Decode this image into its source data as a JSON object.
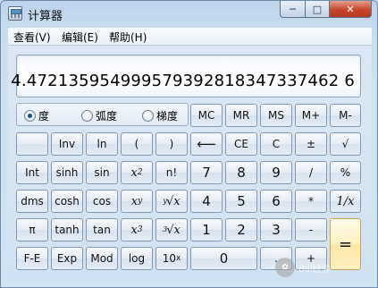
{
  "window": {
    "title": "计算器"
  },
  "titlebar_buttons": {
    "minimize": "─",
    "maximize": "□",
    "close": "✕"
  },
  "menu": [
    {
      "label": "查看(V)"
    },
    {
      "label": "编辑(E)"
    },
    {
      "label": "帮助(H)"
    }
  ],
  "display": {
    "value": "4.472135954999579392818347337462 6"
  },
  "angle_units": {
    "selected": "度",
    "options": [
      {
        "label": "度",
        "selected": true
      },
      {
        "label": "弧度",
        "selected": false
      },
      {
        "label": "梯度",
        "selected": false
      }
    ]
  },
  "keys": {
    "mc": "MC",
    "mr": "MR",
    "ms": "MS",
    "mplus": "M+",
    "mminus": "M-",
    "blank": "",
    "inv": "Inv",
    "ln": "ln",
    "lparen": "(",
    "rparen": ")",
    "backspace": "⟵",
    "ce": "CE",
    "c": "C",
    "plusminus": "±",
    "sqrt": "√",
    "int": "Int",
    "sinh": "sinh",
    "sin": "sin",
    "x2": "x",
    "x2_sup": "2",
    "nfact": "n!",
    "d7": "7",
    "d8": "8",
    "d9": "9",
    "div": "/",
    "pct": "%",
    "dms": "dms",
    "cosh": "cosh",
    "cos": "cos",
    "xy": "x",
    "xy_sup": "y",
    "yrootx_idx": "y",
    "yrootx": "√x",
    "d4": "4",
    "d5": "5",
    "d6": "6",
    "mul": "*",
    "recip": "1/x",
    "pi": "π",
    "tanh": "tanh",
    "tan": "tan",
    "x3": "x",
    "x3_sup": "3",
    "cbrt_idx": "3",
    "cbrt": "√x",
    "d1": "1",
    "d2": "2",
    "d3": "3",
    "sub": "-",
    "equals": "=",
    "fe": "F-E",
    "exp": "Exp",
    "mod": "Mod",
    "log": "log",
    "tenx": "10",
    "tenx_sup": "x",
    "d0": "0",
    "dot": ".",
    "add": "+"
  },
  "watermark": {
    "text": "Bai经验"
  }
}
